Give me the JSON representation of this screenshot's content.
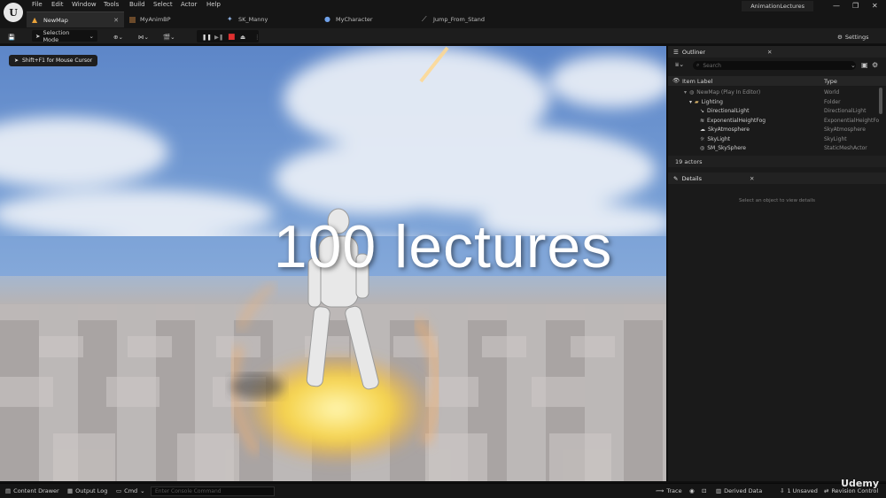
{
  "menu": [
    "File",
    "Edit",
    "Window",
    "Tools",
    "Build",
    "Select",
    "Actor",
    "Help"
  ],
  "app_title": "AnimationLectures",
  "tabs": [
    {
      "label": "NewMap",
      "active": true
    },
    {
      "label": "MyAnimBP",
      "active": false
    },
    {
      "label": "SK_Manny",
      "active": false
    },
    {
      "label": "MyCharacter",
      "active": false
    },
    {
      "label": "Jump_From_Stand",
      "active": false
    }
  ],
  "toolbar": {
    "selection_mode": "Selection Mode",
    "settings": "Settings"
  },
  "viewport": {
    "cursor_hint": "Shift+F1 for Mouse Cursor",
    "overlay": "100 lectures"
  },
  "outliner": {
    "title": "Outliner",
    "search_placeholder": "Search",
    "col_label": "Item Label",
    "col_type": "Type",
    "rows": [
      {
        "label": "NewMap (Play In Editor)",
        "type": "World"
      },
      {
        "label": "Lighting",
        "type": "Folder"
      },
      {
        "label": "DirectionalLight",
        "type": "DirectionalLight"
      },
      {
        "label": "ExponentialHeightFog",
        "type": "ExponentialHeightFo"
      },
      {
        "label": "SkyAtmosphere",
        "type": "SkyAtmosphere"
      },
      {
        "label": "SkyLight",
        "type": "SkyLight"
      },
      {
        "label": "SM_SkySphere",
        "type": "StaticMeshActor"
      }
    ],
    "actor_count": "19 actors"
  },
  "details": {
    "title": "Details",
    "empty_message": "Select an object to view details"
  },
  "statusbar": {
    "content_drawer": "Content Drawer",
    "output_log": "Output Log",
    "cmd": "Cmd",
    "console_placeholder": "Enter Console Command",
    "trace": "Trace",
    "derived_data": "Derived Data",
    "unsaved": "1 Unsaved",
    "revision": "Revision Control"
  },
  "watermark": "Udemy",
  "colors": {
    "accent": "#e8a23a",
    "panel": "#1a1a1a",
    "toolbar": "#1d1d1d"
  }
}
